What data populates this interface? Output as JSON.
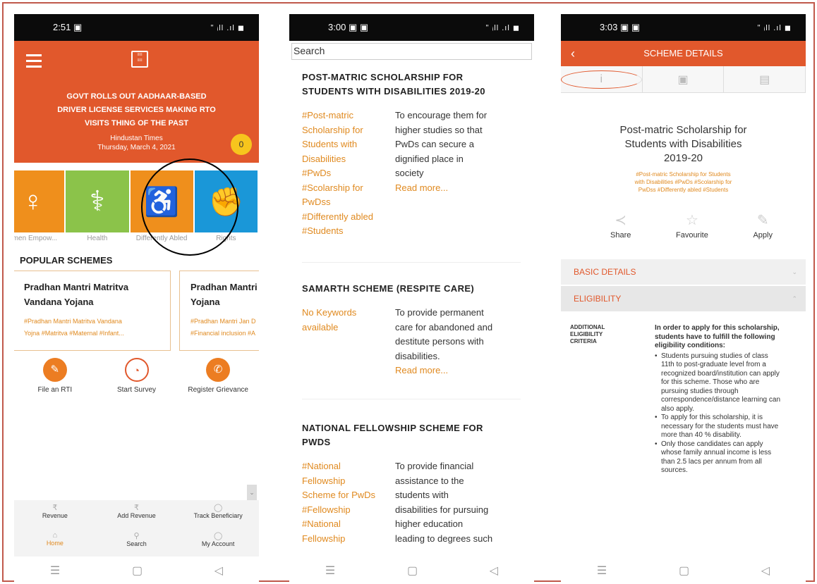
{
  "screen1": {
    "status": {
      "time": "2:51",
      "icons": "▣",
      "right": "ʺ ᵢll .ıl ◼"
    },
    "news": {
      "headline_lines": [
        "GOVT ROLLS OUT AADHAAR-BASED",
        "DRIVER LICENSE SERVICES MAKING RTO",
        "VISITS THING OF THE PAST"
      ],
      "source": "Hindustan Times",
      "date": "Thursday, March 4, 2021",
      "badge": "0"
    },
    "categories": [
      {
        "label": "omen Empow...",
        "color": "#ef8f1c",
        "icon": "♀"
      },
      {
        "label": "Health",
        "color": "#8bc34a",
        "icon": "⚕"
      },
      {
        "label": "Differently Abled",
        "color": "#ef8f1c",
        "icon": "♿"
      },
      {
        "label": "Rights",
        "color": "#1a97d8",
        "icon": "✊"
      }
    ],
    "popular_title": "POPULAR SCHEMES",
    "cards": [
      {
        "title_lines": [
          "Pradhan Mantri Matritva",
          "Vandana Yojana"
        ],
        "kw_lines": [
          "#Pradhan Mantri Matritva Vandana",
          "Yojna #Matritva #Maternal #Infant..."
        ]
      },
      {
        "title_lines": [
          "Pradhan Mantri J",
          "Yojana"
        ],
        "kw_lines": [
          "#Pradhan Mantri Jan D",
          "#Financial inclusion #A"
        ]
      }
    ],
    "actions": [
      "File an RTI",
      "Start Survey",
      "Register Grievance"
    ],
    "bottom": [
      "Revenue",
      "Add Revenue",
      "Track Beneficiary",
      "Home",
      "Search",
      "My Account"
    ]
  },
  "screen2": {
    "status": {
      "time": "3:00",
      "icons": "▣ ▣",
      "right": "ʺ ᵢll .ıl ◼"
    },
    "search_placeholder": "Search",
    "schemes": [
      {
        "title_lines": [
          "POST-MATRIC SCHOLARSHIP FOR",
          "STUDENTS WITH DISABILITIES 2019-20"
        ],
        "kw_lines": [
          "#Post-matric",
          "Scholarship for",
          "Students with",
          "Disabilities",
          "#PwDs",
          "#Scolarship for",
          "PwDss",
          "#Differently abled",
          "#Students"
        ],
        "desc_lines": [
          "To encourage them for",
          "higher studies so that",
          "PwDs can secure a",
          "dignified place in",
          "society"
        ],
        "more": "Read more..."
      },
      {
        "title_lines": [
          "SAMARTH SCHEME (RESPITE CARE)"
        ],
        "kw_lines": [
          "No Keywords",
          "available"
        ],
        "desc_lines": [
          "To provide permanent",
          "care for abandoned and",
          "destitute persons with",
          "disabilities."
        ],
        "more": "Read more..."
      },
      {
        "title_lines": [
          "NATIONAL FELLOWSHIP SCHEME FOR",
          "PWDS"
        ],
        "kw_lines": [
          "#National",
          "Fellowship",
          "Scheme for PwDs",
          "#Fellowship",
          "#National",
          "Fellowship"
        ],
        "desc_lines": [
          "To provide financial",
          "assistance to the",
          "students with",
          "disabilities for pursuing",
          "higher education",
          "leading to degrees such"
        ],
        "more": ""
      }
    ]
  },
  "screen3": {
    "status": {
      "time": "3:03",
      "icons": "▣ ▣",
      "right": "ʺ ᵢll .ıl ◼"
    },
    "header": "SCHEME DETAILS",
    "title_lines": [
      "Post-matric Scholarship for",
      "Students with Disabilities",
      "2019-20"
    ],
    "kw_lines": [
      "#Post-matric Scholarship for Students",
      "with Disabilities #PwDs #Scolarship for",
      "PwDss #Differently abled #Students"
    ],
    "share": "Share",
    "favourite": "Favourite",
    "apply": "Apply",
    "basic": "BASIC DETAILS",
    "eligibility": "ELIGIBILITY",
    "criteria_label_lines": [
      "ADDITIONAL",
      "ELIGIBILITY",
      "CRITERIA"
    ],
    "criteria_intro": "In order to apply for this scholarship, students have to fulfill the following eligibility conditions:",
    "criteria": [
      "Students pursuing studies of class 11th to post-graduate level from a recognized board/institution can apply for this scheme. Those who are pursuing studies through correspondence/distance learning can also apply.",
      "To apply for this scholarship, it is necessary for the students must have more than 40 % disability.",
      "Only those candidates can apply whose family annual income is less than 2.5 lacs per annum from all sources."
    ]
  }
}
